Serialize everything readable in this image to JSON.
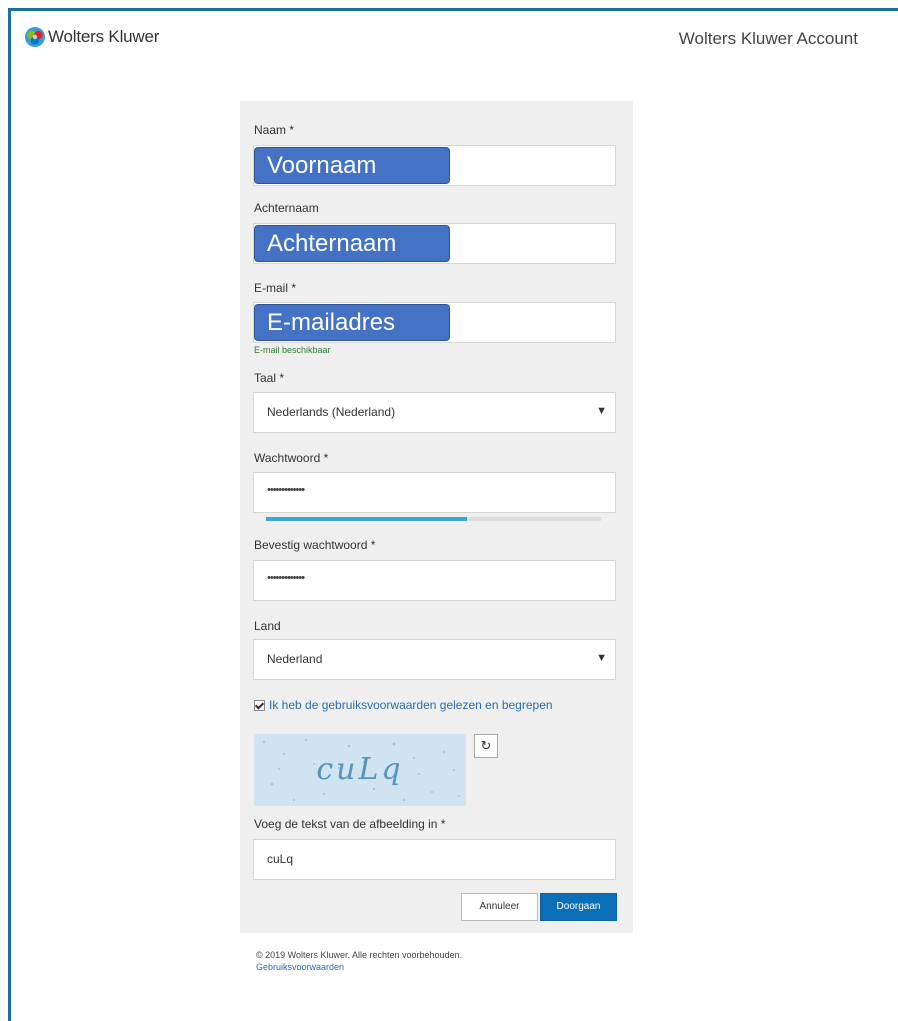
{
  "header": {
    "brand_name": "Wolters Kluwer",
    "account_title": "Wolters Kluwer Account",
    "brand_colors": [
      "#85bc20",
      "#e5202e",
      "#007ac3",
      "#409bd2"
    ]
  },
  "form": {
    "first_name": {
      "label": "Naam *",
      "overlay_text": "Voornaam"
    },
    "last_name": {
      "label": "Achternaam",
      "overlay_text": "Achternaam"
    },
    "email": {
      "label": "E-mail *",
      "overlay_text": "E-mailadres",
      "hint": "E-mail beschikbaar"
    },
    "language": {
      "label": "Taal *",
      "selected": "Nederlands (Nederland)"
    },
    "password": {
      "label": "Wachtwoord *",
      "masked_value": "•••••••••••••",
      "strength_fraction": 0.6
    },
    "confirm_password": {
      "label": "Bevestig wachtwoord *",
      "masked_value": "•••••••••••••"
    },
    "country": {
      "label": "Land",
      "selected": "Nederland"
    },
    "terms": {
      "label": "Ik heb de gebruiksvoorwaarden gelezen en begrepen",
      "checked": true
    },
    "captcha": {
      "image_text": "cuLq",
      "refresh_icon": "refresh-icon",
      "input_label": "Voeg de tekst van de afbeelding in *",
      "input_value": "cuLq"
    },
    "buttons": {
      "cancel": "Annuleer",
      "continue": "Doorgaan"
    }
  },
  "footer": {
    "copyright": "© 2019 Wolters Kluwer. Alle rechten voorbehouden.",
    "terms_link": "Gebruiksvoorwaarden"
  }
}
